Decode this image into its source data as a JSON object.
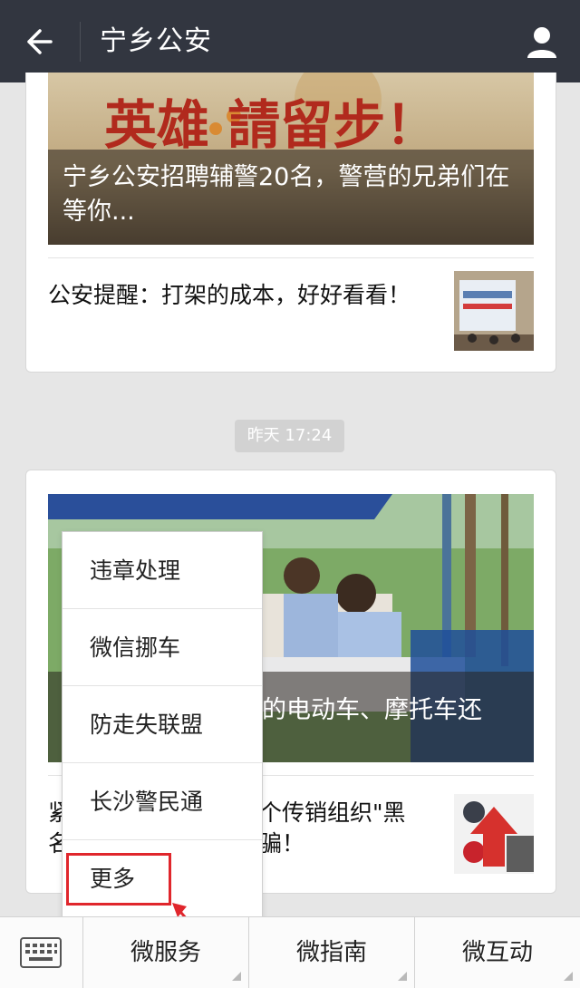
{
  "header": {
    "title": "宁乡公安"
  },
  "feed": {
    "card1": {
      "hero_banner_text": "英雄 請留步！",
      "hero_title": "宁乡公安招聘辅警20名，警营的兄弟们在等你...",
      "item_title": "公安提醒：打架的成本，好好看看！"
    },
    "timestamp": "昨天 17:24",
    "card2": {
      "hero_title_visible": "的电动车、摩托车还",
      "item_title_line1_left": "紧",
      "item_title_line1_right": "个传销组织\"黑",
      "item_title_line2_left": "名",
      "item_title_line2_right": "骗！"
    }
  },
  "popup_menu": {
    "items": [
      {
        "label": "违章处理"
      },
      {
        "label": "微信挪车"
      },
      {
        "label": "防走失联盟"
      },
      {
        "label": "长沙警民通"
      },
      {
        "label": "更多"
      }
    ],
    "highlight_color": "#e0262c"
  },
  "bottom_bar": {
    "tabs": [
      {
        "label": "微服务"
      },
      {
        "label": "微指南"
      },
      {
        "label": "微互动"
      }
    ]
  },
  "colors": {
    "topbar": "#323640",
    "background": "#e6e6e6"
  }
}
